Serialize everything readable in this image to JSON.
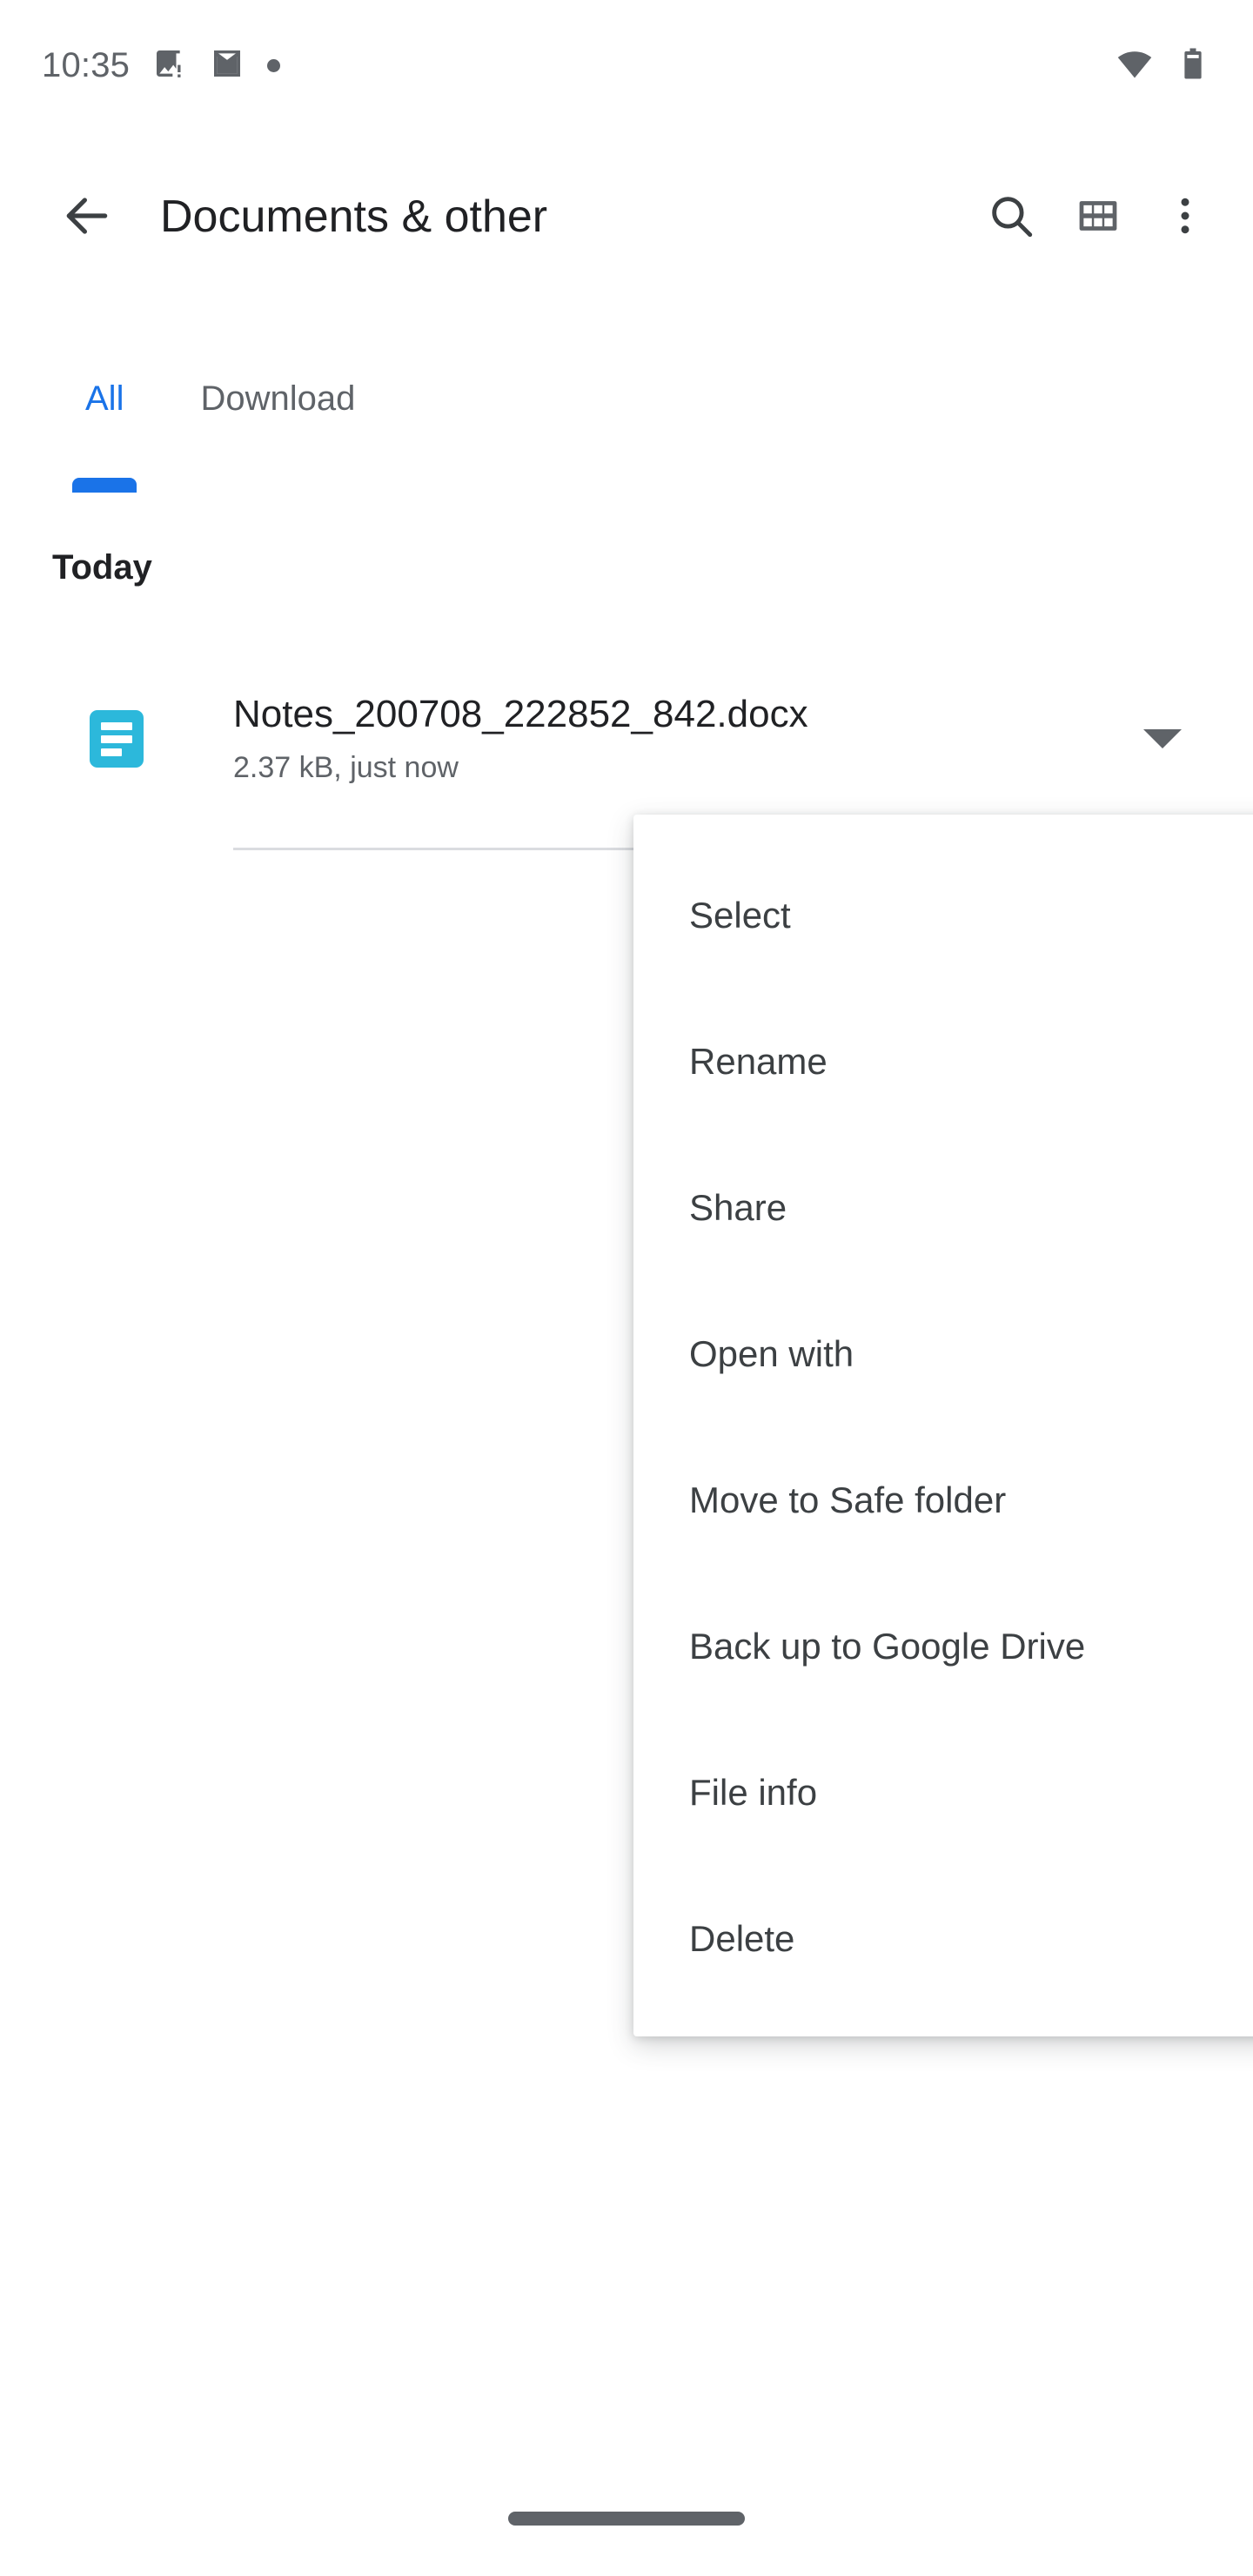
{
  "status_bar": {
    "time": "10:35",
    "left_icons": [
      {
        "name": "photo-alert-icon"
      },
      {
        "name": "gmail-icon"
      },
      {
        "name": "notification-dot-icon"
      }
    ],
    "right_icons": [
      {
        "name": "wifi-icon"
      },
      {
        "name": "battery-icon"
      }
    ]
  },
  "app_bar": {
    "back_icon": "back-arrow-icon",
    "title": "Documents & other",
    "actions": [
      {
        "name": "search-icon",
        "label": "Search"
      },
      {
        "name": "grid-view-icon",
        "label": "Grid view"
      },
      {
        "name": "overflow-menu-icon",
        "label": "More options"
      }
    ]
  },
  "tabs": {
    "active_index": 0,
    "items": [
      {
        "label": "All"
      },
      {
        "label": "Download"
      }
    ],
    "accent_color": "#1a73e8"
  },
  "content": {
    "section_header": "Today",
    "files": [
      {
        "icon": "document-icon",
        "icon_color": "#2cb8db",
        "name": "Notes_200708_222852_842.docx",
        "meta": "2.37 kB, just now",
        "caret": "chevron-down-icon"
      }
    ]
  },
  "context_menu": {
    "visible": true,
    "items": [
      {
        "label": "Select"
      },
      {
        "label": "Rename"
      },
      {
        "label": "Share"
      },
      {
        "label": "Open with"
      },
      {
        "label": "Move to Safe folder"
      },
      {
        "label": "Back up to Google Drive"
      },
      {
        "label": "File info"
      },
      {
        "label": "Delete"
      }
    ]
  },
  "nav_bar": {
    "pill": "home-gesture-pill"
  }
}
